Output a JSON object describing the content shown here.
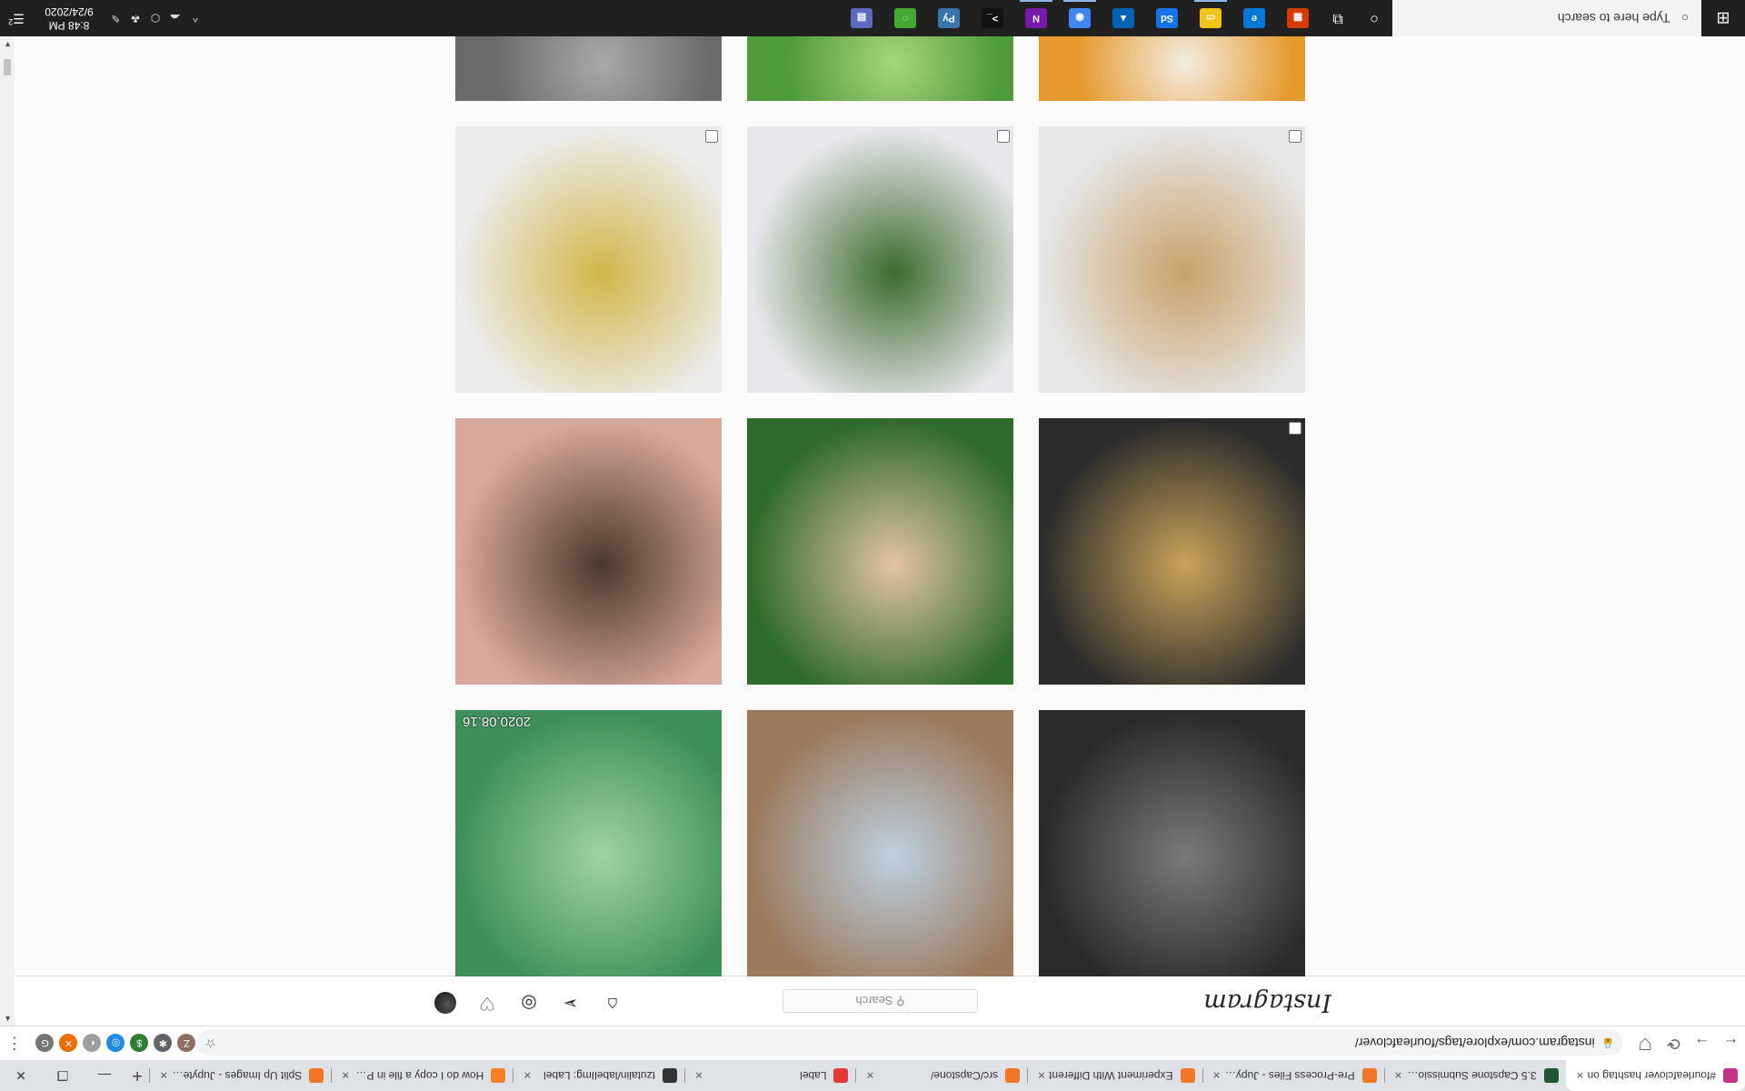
{
  "browser": {
    "tabs": [
      {
        "title": "#fourleafclover hashtag on",
        "favicon": "instagram-icon",
        "color": "#c13584",
        "active": true
      },
      {
        "title": "3.5 Capstone Submission - ",
        "favicon": "jupyter-icon",
        "color": "#1e5631"
      },
      {
        "title": "Pre-Process Files - Jupyter",
        "favicon": "jupyter-icon",
        "color": "#f37626"
      },
      {
        "title": "Experiment With Different ",
        "favicon": "jupyter-icon",
        "color": "#f37626"
      },
      {
        "title": "src/Capstone/",
        "favicon": "jupyter-icon",
        "color": "#f37626"
      },
      {
        "title": "Label",
        "favicon": "labelling-icon",
        "color": "#e53935"
      },
      {
        "title": "tzutalin/labelImg: Label",
        "favicon": "github-icon",
        "color": "#333333"
      },
      {
        "title": "How do I copy a file in Pyth",
        "favicon": "stackoverflow-icon",
        "color": "#f48024"
      },
      {
        "title": "Split Up Images - Jupyter N",
        "favicon": "jupyter-icon",
        "color": "#f37626"
      }
    ],
    "new_tab_symbol": "+",
    "window_controls": {
      "minimize": "—",
      "maximize": "❐",
      "close": "✕"
    },
    "url": "instagram.com/explore/tags/fourleafclover/",
    "nav": {
      "back": "←",
      "forward": "→",
      "reload": "⟳",
      "shield": "⛉"
    },
    "extensions": [
      {
        "name": "profile-avatar",
        "label": "Z",
        "color": "#8d6e63"
      },
      {
        "name": "puzzle-extension",
        "label": "✱",
        "color": "#5f6368"
      },
      {
        "name": "money-extension",
        "label": "$",
        "color": "#2e7d32"
      },
      {
        "name": "blue-extension",
        "label": "◎",
        "color": "#1e88e5"
      },
      {
        "name": "gray-extension",
        "label": "◐",
        "color": "#9e9e9e"
      },
      {
        "name": "orange-extension",
        "label": "✕",
        "color": "#ef6c00"
      },
      {
        "name": "g-extension",
        "label": "G",
        "color": "#757575"
      }
    ],
    "menu_symbol": "⋮"
  },
  "instagram": {
    "logo": "Instagram",
    "search_placeholder": "Search",
    "nav_icons": [
      "home-icon",
      "direct-icon",
      "explore-icon",
      "activity-icon",
      "profile-avatar"
    ]
  },
  "feed": {
    "tiles": [
      {
        "name": "photo-selfie-sunglasses",
        "colors": [
          "#2a2a2a",
          "#7a7a7a"
        ]
      },
      {
        "name": "photo-clover-tattoo",
        "colors": [
          "#9b7a5e",
          "#bcd0e0"
        ]
      },
      {
        "name": "photo-four-leaf-clover-patch",
        "colors": [
          "#3f8f5a",
          "#9fd3a5"
        ],
        "stamp": "2020.08.16"
      },
      {
        "name": "photo-bakery-display",
        "colors": [
          "#2b2b2b",
          "#c9a35a"
        ],
        "checkbox": true
      },
      {
        "name": "photo-hand-holding-clover",
        "colors": [
          "#2f6b2a",
          "#e4c3a5"
        ]
      },
      {
        "name": "photo-jewelry-in-hand",
        "colors": [
          "#d9a89c",
          "#4a3a2c"
        ]
      },
      {
        "name": "photo-clover-ring",
        "colors": [
          "#e6e6e6",
          "#c9a26b"
        ],
        "checkbox": true
      },
      {
        "name": "photo-clover-pendant",
        "colors": [
          "#e8e8ec",
          "#3d6b2e"
        ],
        "checkbox": true
      },
      {
        "name": "photo-resin-letters",
        "colors": [
          "#ececec",
          "#d2b64a"
        ],
        "checkbox": true
      },
      {
        "name": "photo-orange-crochet-flower",
        "colors": [
          "#e69a2e",
          "#f3ece2"
        ],
        "checkbox": true
      },
      {
        "name": "photo-green-grass",
        "colors": [
          "#4f9a3a",
          "#a6d67a"
        ]
      },
      {
        "name": "photo-granite-stone",
        "colors": [
          "#6b6b6b",
          "#a9a9a9"
        ]
      }
    ]
  },
  "taskbar": {
    "search_placeholder": "Type here to search",
    "search_icon": "○",
    "cortana_icon": "○",
    "task_view_icon": "⧉",
    "apps": [
      {
        "name": "office-app",
        "label": "▦",
        "color": "#d83b01"
      },
      {
        "name": "edge-app",
        "label": "e",
        "color": "#0078d7"
      },
      {
        "name": "file-explorer-app",
        "label": "▭",
        "color": "#f0c419",
        "running": true
      },
      {
        "name": "photoshop-app",
        "label": "Sd",
        "color": "#1473e6"
      },
      {
        "name": "photos-app",
        "label": "▲",
        "color": "#0063b1"
      },
      {
        "name": "chrome-app",
        "label": "◉",
        "color": "#4285f4",
        "running": true
      },
      {
        "name": "onenote-app",
        "label": "N",
        "color": "#7719aa",
        "running": true
      },
      {
        "name": "terminal-app",
        "label": ">_",
        "color": "#111111"
      },
      {
        "name": "python-app",
        "label": "Py",
        "color": "#3776ab"
      },
      {
        "name": "anaconda-app",
        "label": "◌",
        "color": "#44a833"
      },
      {
        "name": "calculator-app",
        "label": "▤",
        "color": "#5c6bc0"
      }
    ],
    "tray": [
      "^",
      "☁",
      "⬡",
      "☘",
      "✎"
    ],
    "time": "8:48 PM",
    "date": "9/24/2020",
    "notification_icon": "☰",
    "notification_count": "2"
  }
}
